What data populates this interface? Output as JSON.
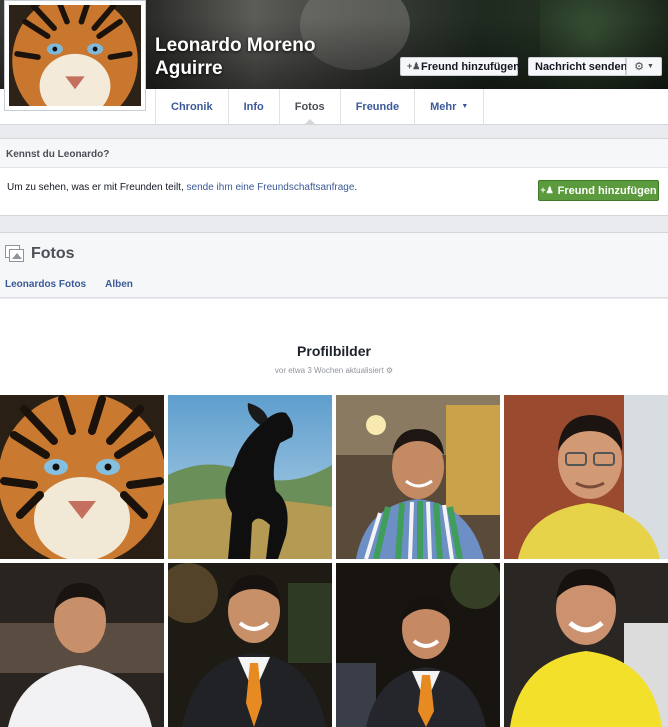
{
  "profile": {
    "name_line1": "Leonardo Moreno",
    "name_line2": "Aguirre",
    "add_friend_label": "Freund hinzufügen",
    "send_message_label": "Nachricht senden"
  },
  "tabs": [
    {
      "label": "Chronik"
    },
    {
      "label": "Info"
    },
    {
      "label": "Fotos"
    },
    {
      "label": "Freunde"
    },
    {
      "label": "Mehr"
    }
  ],
  "know": {
    "header": "Kennst du Leonardo?",
    "text_prefix": "Um zu sehen, was er mit Freunden teilt, ",
    "link": "sende ihm eine Freundschaftsanfrage",
    "text_suffix": ".",
    "button": "Freund hinzufügen"
  },
  "photos": {
    "title": "Fotos",
    "subtabs": [
      {
        "label": "Leonardos Fotos"
      },
      {
        "label": "Alben"
      }
    ],
    "album": {
      "title": "Profilbilder",
      "updated": "vor etwa 3 Wochen aktualisiert"
    }
  },
  "colors": {
    "link": "#3b5998",
    "green_button": "#5b9b3d"
  }
}
